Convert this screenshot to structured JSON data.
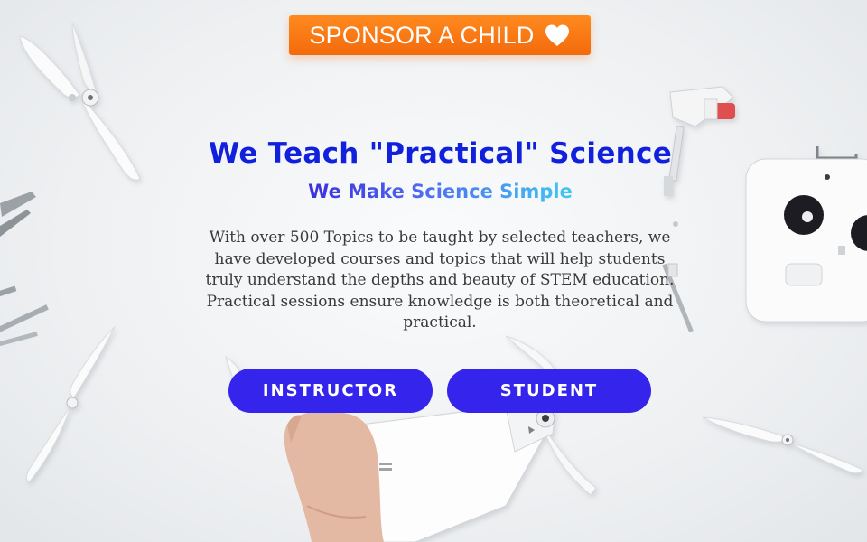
{
  "sponsor": {
    "label": "SPONSOR A CHILD",
    "icon": "heart-icon"
  },
  "hero": {
    "title": "We Teach \"Practical\" Science",
    "subtitle": "We Make Science Simple",
    "body": "With over 500 Topics to be taught by selected teachers, we have developed courses and topics that will help students truly understand the depths and beauty of STEM education. Practical sessions ensure knowledge is both theoretical and practical."
  },
  "buttons": {
    "instructor": "INSTRUCTOR",
    "student": "STUDENT"
  },
  "colors": {
    "sponsor_orange": "#f7781a",
    "title_blue": "#1020dd",
    "button_indigo": "#3524ec",
    "body_text": "#3a3a3a"
  }
}
